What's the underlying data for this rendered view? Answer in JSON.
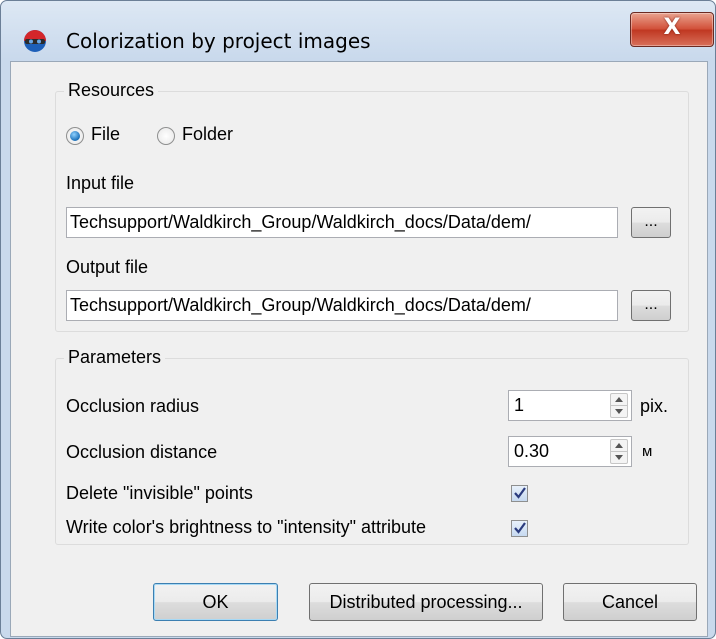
{
  "window": {
    "title": "Colorization by project images",
    "close_label": "X"
  },
  "resources": {
    "legend": "Resources",
    "radio_file": "File",
    "radio_folder": "Folder",
    "selected": "File",
    "input_label": "Input file",
    "input_value": "Techsupport/Waldkirch_Group/Waldkirch_docs/Data/dem/",
    "input_browse": "...",
    "output_label": "Output file",
    "output_value": "Techsupport/Waldkirch_Group/Waldkirch_docs/Data/dem/",
    "output_browse": "..."
  },
  "parameters": {
    "legend": "Parameters",
    "occlusion_radius_label": "Occlusion radius",
    "occlusion_radius_value": "1",
    "occlusion_radius_unit": "pix.",
    "occlusion_distance_label": "Occlusion distance",
    "occlusion_distance_value": "0.30",
    "occlusion_distance_unit": "м",
    "delete_invisible_label": "Delete \"invisible\" points",
    "delete_invisible_checked": true,
    "write_brightness_label": "Write color's brightness to \"intensity\" attribute",
    "write_brightness_checked": true
  },
  "buttons": {
    "ok": "OK",
    "distributed": "Distributed processing...",
    "cancel": "Cancel"
  }
}
